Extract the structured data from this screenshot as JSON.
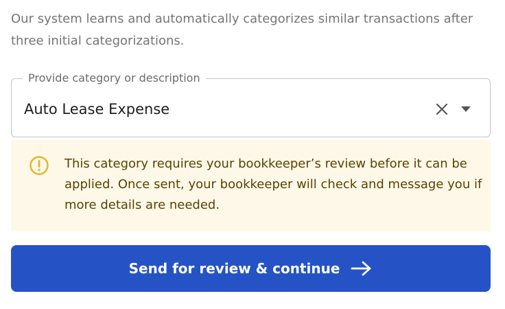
{
  "intro": {
    "text": "Our system learns and automatically categorizes similar transactions after three initial categorizations."
  },
  "category_field": {
    "label": "Provide category or description",
    "value": "Auto Lease Expense",
    "clear_icon": "close-icon",
    "dropdown_icon": "caret-down-icon"
  },
  "notice": {
    "icon": "warning-circle-icon",
    "text": "This category requires your bookkeeper’s review before it can be applied. Once sent, your bookkeeper will check and message you if more details are needed.",
    "colors": {
      "background": "#fdf8e8",
      "icon": "#e6b52e",
      "text": "#5a4200"
    }
  },
  "submit": {
    "label": "Send for review & continue",
    "icon": "arrow-right-icon",
    "color": "#2553c6"
  }
}
